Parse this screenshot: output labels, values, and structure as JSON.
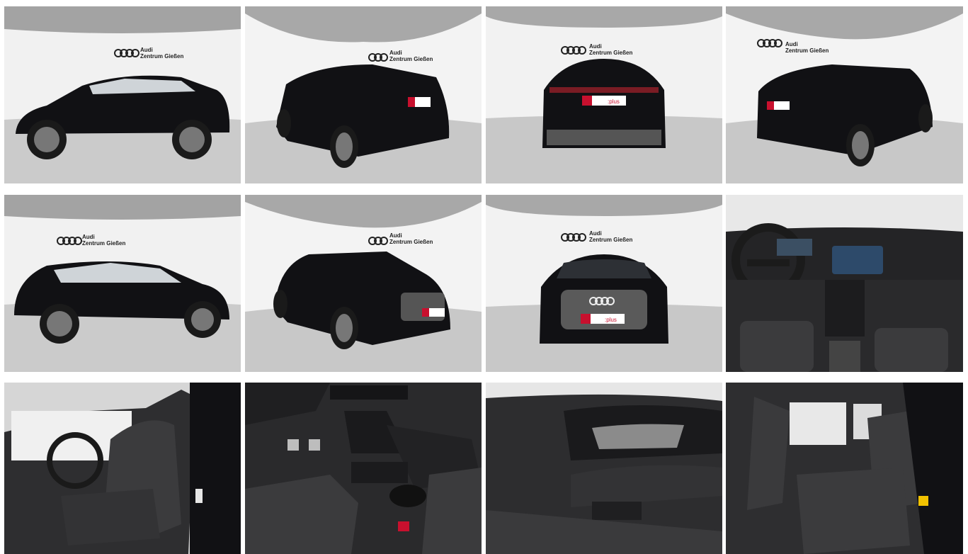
{
  "gallery": {
    "dealer_logo_text_line1": "Audi",
    "dealer_logo_text_line2": "Zentrum Gießen",
    "plate_text": ":plus",
    "photos": [
      {
        "kind": "side-left",
        "icon": "car-side-photo"
      },
      {
        "kind": "rear-three-quarter-left",
        "icon": "car-rear-34-photo"
      },
      {
        "kind": "rear",
        "icon": "car-rear-photo"
      },
      {
        "kind": "rear-three-quarter-right",
        "icon": "car-rear-34-photo"
      },
      {
        "kind": "side-right",
        "icon": "car-side-photo"
      },
      {
        "kind": "front-three-quarter",
        "icon": "car-front-34-photo"
      },
      {
        "kind": "front",
        "icon": "car-front-photo"
      },
      {
        "kind": "dashboard",
        "icon": "interior-dashboard-photo"
      },
      {
        "kind": "front-seats",
        "icon": "interior-seats-photo"
      },
      {
        "kind": "center-console",
        "icon": "interior-console-photo"
      },
      {
        "kind": "door-panel",
        "icon": "interior-door-photo"
      },
      {
        "kind": "rear-seats",
        "icon": "interior-rear-seats-photo"
      }
    ]
  },
  "colors": {
    "car_paint": "#111114",
    "showroom_wall": "#f2f2f2",
    "showroom_floor": "#c9c9c9",
    "ceiling": "#9a9a9a",
    "leather": "#3b3b3d",
    "plate_red": "#c8102e"
  }
}
